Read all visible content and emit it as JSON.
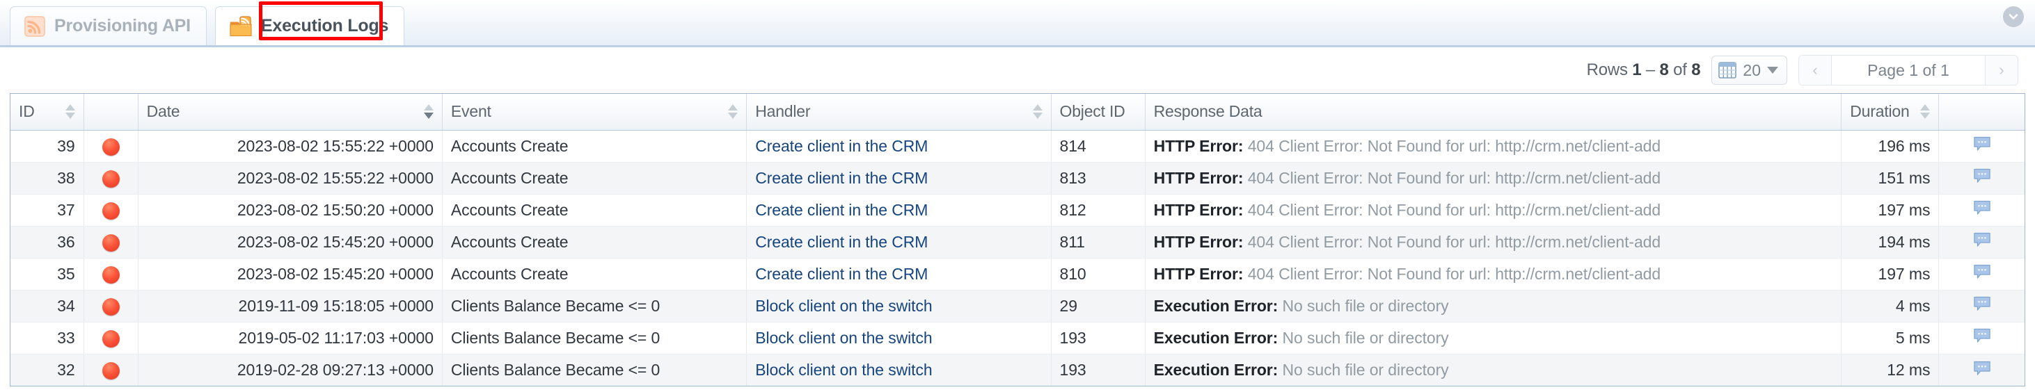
{
  "tabs": [
    {
      "label": "Provisioning API",
      "icon": "rss-icon",
      "active": false
    },
    {
      "label": "Execution Logs",
      "icon": "folder-rss-icon",
      "active": true
    }
  ],
  "collapse_button": {
    "icon": "chevron-down-icon"
  },
  "toolbar": {
    "rows_prefix": "Rows",
    "rows_from": "1",
    "rows_dash": "–",
    "rows_to": "8",
    "rows_of": "of",
    "rows_total": "8",
    "page_size": "20",
    "page_size_icon": "grid-icon",
    "prev_label": "‹",
    "next_label": "›",
    "page_label": "Page 1 of 1"
  },
  "table": {
    "columns": [
      {
        "key": "id",
        "label": "ID",
        "sortable": true,
        "sort_active": false
      },
      {
        "key": "status",
        "label": "",
        "sortable": false,
        "sort_active": false
      },
      {
        "key": "date",
        "label": "Date",
        "sortable": true,
        "sort_active": true
      },
      {
        "key": "event",
        "label": "Event",
        "sortable": true,
        "sort_active": false
      },
      {
        "key": "handler",
        "label": "Handler",
        "sortable": true,
        "sort_active": false
      },
      {
        "key": "objectid",
        "label": "Object ID",
        "sortable": false,
        "sort_active": false
      },
      {
        "key": "response",
        "label": "Response Data",
        "sortable": false,
        "sort_active": false
      },
      {
        "key": "duration",
        "label": "Duration",
        "sortable": true,
        "sort_active": false
      },
      {
        "key": "note",
        "label": "",
        "sortable": false,
        "sort_active": false
      }
    ],
    "rows": [
      {
        "id": "39",
        "status": "error",
        "date": "2023-08-02 15:55:22 +0000",
        "event": "Accounts Create",
        "handler": "Create client in the CRM",
        "objectid": "814",
        "response_key": "HTTP Error:",
        "response_val": "404 Client Error: Not Found for url: http://crm.net/client-add",
        "duration": "196 ms",
        "note_icon": "comment-icon"
      },
      {
        "id": "38",
        "status": "error",
        "date": "2023-08-02 15:55:22 +0000",
        "event": "Accounts Create",
        "handler": "Create client in the CRM",
        "objectid": "813",
        "response_key": "HTTP Error:",
        "response_val": "404 Client Error: Not Found for url: http://crm.net/client-add",
        "duration": "151 ms",
        "note_icon": "comment-icon"
      },
      {
        "id": "37",
        "status": "error",
        "date": "2023-08-02 15:50:20 +0000",
        "event": "Accounts Create",
        "handler": "Create client in the CRM",
        "objectid": "812",
        "response_key": "HTTP Error:",
        "response_val": "404 Client Error: Not Found for url: http://crm.net/client-add",
        "duration": "197 ms",
        "note_icon": "comment-icon"
      },
      {
        "id": "36",
        "status": "error",
        "date": "2023-08-02 15:45:20 +0000",
        "event": "Accounts Create",
        "handler": "Create client in the CRM",
        "objectid": "811",
        "response_key": "HTTP Error:",
        "response_val": "404 Client Error: Not Found for url: http://crm.net/client-add",
        "duration": "194 ms",
        "note_icon": "comment-icon"
      },
      {
        "id": "35",
        "status": "error",
        "date": "2023-08-02 15:45:20 +0000",
        "event": "Accounts Create",
        "handler": "Create client in the CRM",
        "objectid": "810",
        "response_key": "HTTP Error:",
        "response_val": "404 Client Error: Not Found for url: http://crm.net/client-add",
        "duration": "197 ms",
        "note_icon": "comment-icon"
      },
      {
        "id": "34",
        "status": "error",
        "date": "2019-11-09 15:18:05 +0000",
        "event": "Clients Balance Became <= 0",
        "handler": "Block client on the switch",
        "objectid": "29",
        "response_key": "Execution Error:",
        "response_val": "No such file or directory",
        "duration": "4 ms",
        "note_icon": "comment-icon"
      },
      {
        "id": "33",
        "status": "error",
        "date": "2019-05-02 11:17:03 +0000",
        "event": "Clients Balance Became <= 0",
        "handler": "Block client on the switch",
        "objectid": "193",
        "response_key": "Execution Error:",
        "response_val": "No such file or directory",
        "duration": "5 ms",
        "note_icon": "comment-icon"
      },
      {
        "id": "32",
        "status": "error",
        "date": "2019-02-28 09:27:13 +0000",
        "event": "Clients Balance Became <= 0",
        "handler": "Block client on the switch",
        "objectid": "193",
        "response_key": "Execution Error:",
        "response_val": "No such file or directory",
        "duration": "12 ms",
        "note_icon": "comment-icon"
      }
    ]
  },
  "colors": {
    "status_error": "#e8331c",
    "handler_link": "#17457f",
    "annotation": "#ff0000",
    "table_border": "#9fb6cd"
  }
}
